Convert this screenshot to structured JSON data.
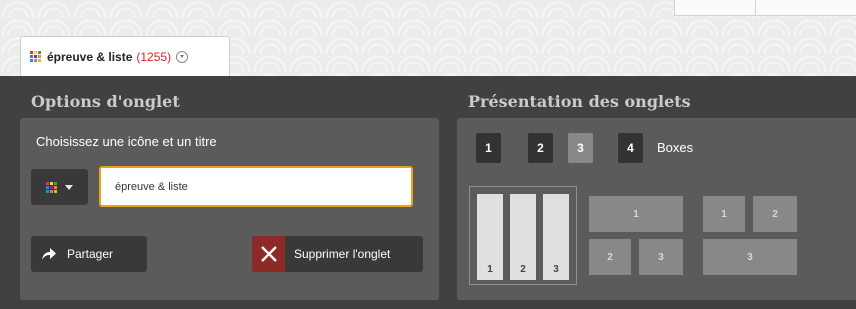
{
  "tab": {
    "title": "épreuve & liste",
    "count": "(1255)"
  },
  "icon_colors": [
    "#e53935",
    "#fdd835",
    "#43a047",
    "#1e88e5",
    "#8e24aa",
    "#fb8c00",
    "#00acc1",
    "#f06292",
    "#c0ca33"
  ],
  "left_panel": {
    "title": "Options d'onglet",
    "choose_label": "Choisissez une icône et un titre",
    "title_input_value": "épreuve & liste",
    "share_label": "Partager",
    "delete_label": "Supprimer l'onglet"
  },
  "right_panel": {
    "title": "Présentation des onglets",
    "column_options": [
      "1",
      "2",
      "3",
      "4"
    ],
    "selected_columns": "3",
    "boxes_label": "Boxes",
    "layouts": [
      {
        "cells": [
          "1",
          "2",
          "3"
        ]
      },
      {
        "cells": [
          "1",
          "2",
          "3"
        ]
      },
      {
        "cells": [
          "1",
          "2",
          "3"
        ]
      }
    ]
  },
  "colors": {
    "panel_bg": "#414141",
    "box_bg": "#5b5b5b",
    "input_border": "#e8a317",
    "delete_accent": "#8c2a28",
    "count_red": "#d4262e"
  }
}
